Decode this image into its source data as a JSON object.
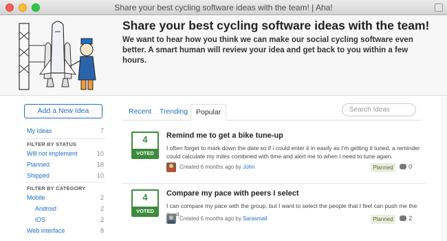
{
  "window": {
    "title": "Share your best cycling software ideas with the team! | Aha!"
  },
  "header": {
    "title": "Share your best cycling software ideas with the team!",
    "subtitle": "We want to hear how you think we can make our social cycling software even better. A smart human will review your idea and get back to you within a few hours."
  },
  "sidebar": {
    "add_button": "Add a New Idea",
    "my_ideas": {
      "label": "My Ideas",
      "count": "7"
    },
    "status_heading": "FILTER BY STATUS",
    "statuses": [
      {
        "label": "Will not implement",
        "count": "10"
      },
      {
        "label": "Planned",
        "count": "18"
      },
      {
        "label": "Shipped",
        "count": "10"
      }
    ],
    "category_heading": "FILTER BY CATEGORY",
    "categories": [
      {
        "label": "Mobile",
        "count": "2"
      },
      {
        "label": "Android",
        "count": "2"
      },
      {
        "label": "iOS",
        "count": "2"
      },
      {
        "label": "Web interface",
        "count": "8"
      }
    ]
  },
  "tabs": [
    {
      "label": "Recent"
    },
    {
      "label": "Trending"
    },
    {
      "label": "Popular"
    }
  ],
  "search": {
    "placeholder": "Search Ideas"
  },
  "ideas": [
    {
      "votes": "4",
      "voted_label": "VOTED",
      "title": "Remind me to get a bike tune-up",
      "description": "I often forget to mark down the date so if i could enter it in easily as I'm getting it tuned, a reminder could calculate my miles combined with time and alert me to when I need to tune again.",
      "meta_prefix": "Created 6 months ago by ",
      "author": "John",
      "status": "Planned",
      "comments": "0"
    },
    {
      "votes": "4",
      "voted_label": "VOTED",
      "title": "Compare my pace with peers I select",
      "description": "I can compare my pace with the group, but I want to select the people that I feel can push me the most.",
      "meta_prefix": "Created 6 months ago by ",
      "author": "Sarasmall",
      "status": "Planned",
      "comments": "2"
    }
  ],
  "colors": {
    "accent": "#1c6fc3",
    "vote_green": "#3d8b3d",
    "badge_bg": "#e8eddc"
  }
}
